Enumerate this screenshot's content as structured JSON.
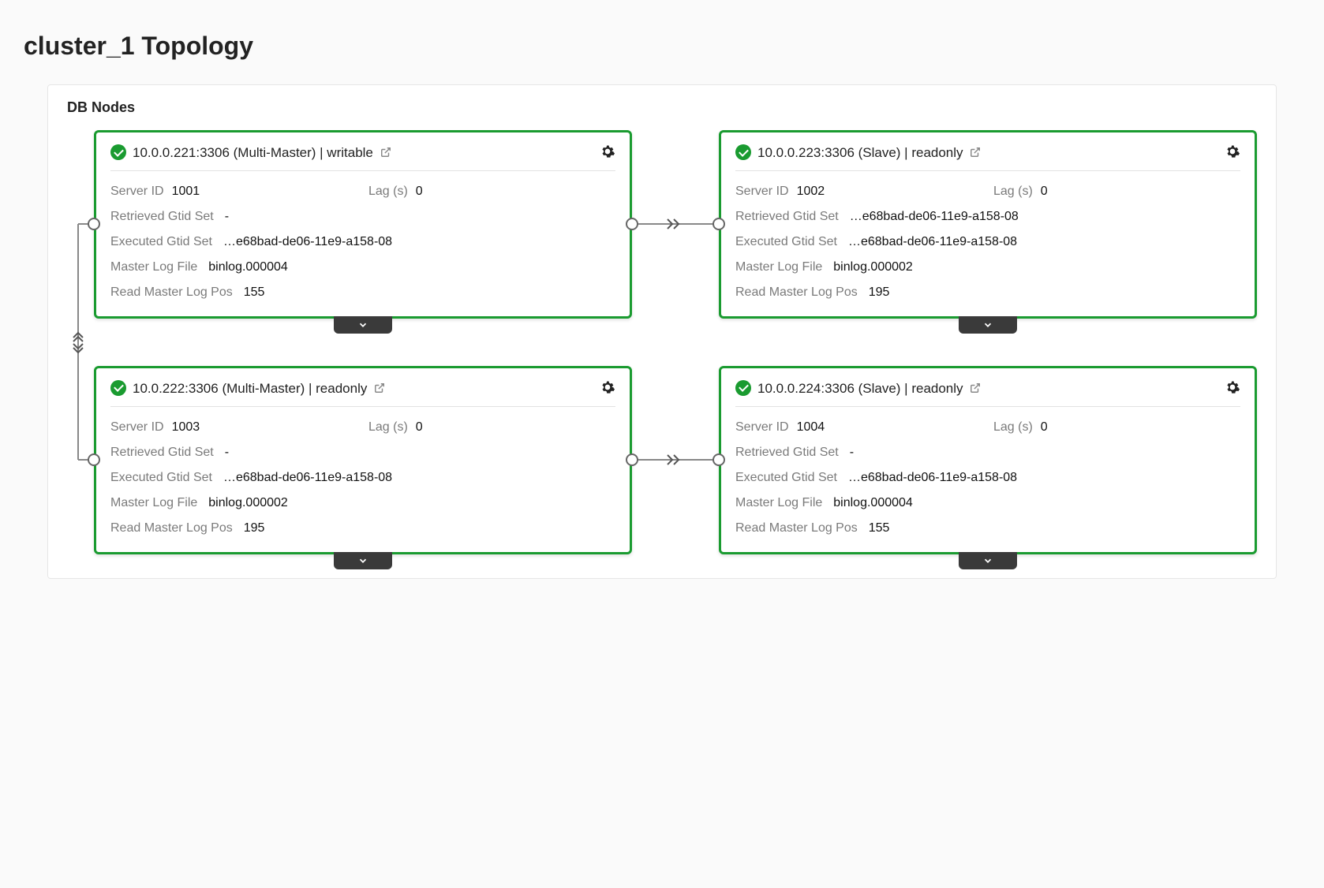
{
  "page_title": "cluster_1 Topology",
  "panel_title": "DB Nodes",
  "labels": {
    "server_id": "Server ID",
    "lag": "Lag (s)",
    "retrieved_gtid": "Retrieved Gtid Set",
    "executed_gtid": "Executed Gtid Set",
    "master_log_file": "Master Log File",
    "read_master_log_pos": "Read Master Log Pos"
  },
  "nodes": [
    {
      "title": "10.0.0.221:3306 (Multi-Master) | writable",
      "server_id": "1001",
      "lag": "0",
      "retrieved_gtid": "-",
      "executed_gtid": "…e68bad-de06-11e9-a158-08",
      "master_log_file": "binlog.000004",
      "read_master_log_pos": "155"
    },
    {
      "title": "10.0.0.223:3306 (Slave) | readonly",
      "server_id": "1002",
      "lag": "0",
      "retrieved_gtid": "…e68bad-de06-11e9-a158-08",
      "executed_gtid": "…e68bad-de06-11e9-a158-08",
      "master_log_file": "binlog.000002",
      "read_master_log_pos": "195"
    },
    {
      "title": "10.0.222:3306 (Multi-Master) | readonly",
      "server_id": "1003",
      "lag": "0",
      "retrieved_gtid": "-",
      "executed_gtid": "…e68bad-de06-11e9-a158-08",
      "master_log_file": "binlog.000002",
      "read_master_log_pos": "195"
    },
    {
      "title": "10.0.0.224:3306 (Slave) | readonly",
      "server_id": "1004",
      "lag": "0",
      "retrieved_gtid": "-",
      "executed_gtid": "…e68bad-de06-11e9-a158-08",
      "master_log_file": "binlog.000004",
      "read_master_log_pos": "155"
    }
  ]
}
